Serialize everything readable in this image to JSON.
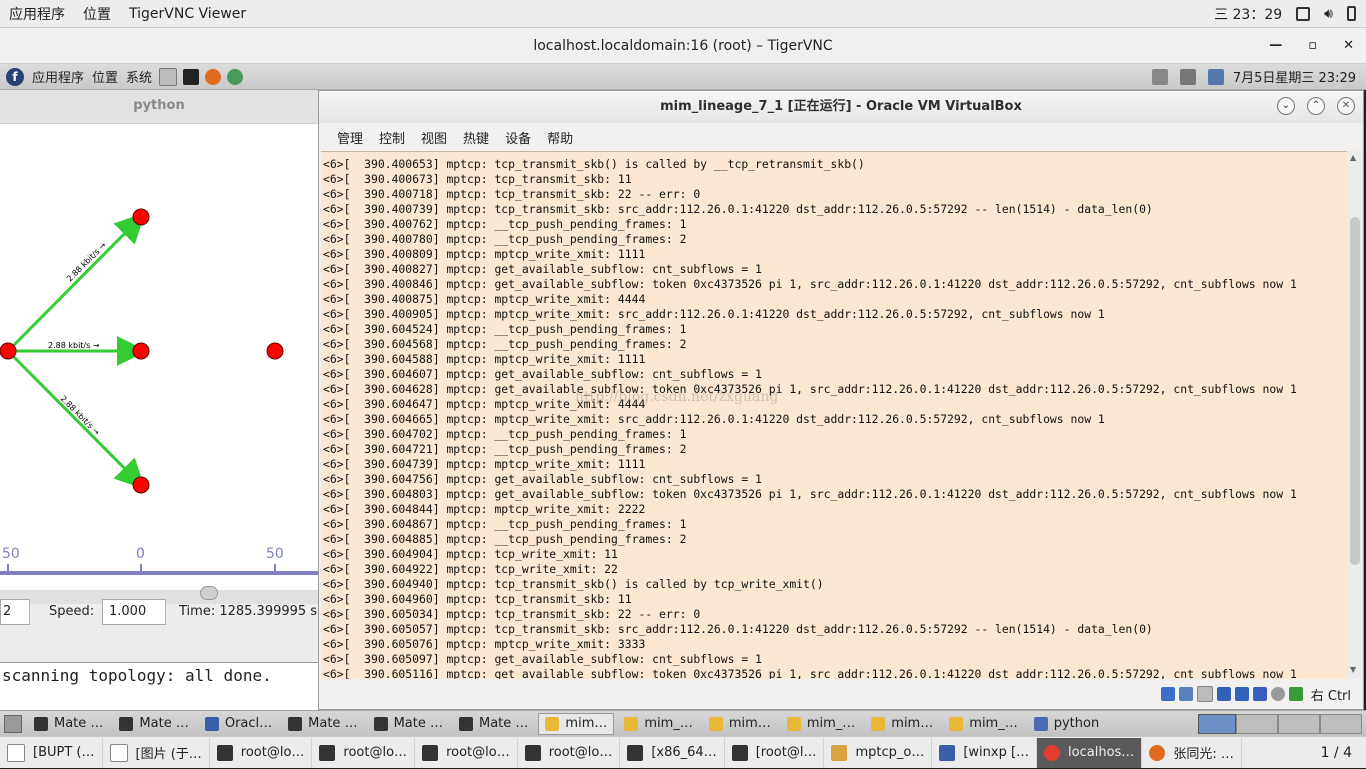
{
  "topbar": {
    "applications": "应用程序",
    "places": "位置",
    "app_name": "TigerVNC Viewer",
    "clock": "三 23：29"
  },
  "vnc_window": {
    "title": "localhost.localdomain:16 (root) – TigerVNC"
  },
  "remote_panel": {
    "applications": "应用程序",
    "places": "位置",
    "system": "系统",
    "datetime": "7月5日星期三 23:29"
  },
  "python_window": {
    "title": "python",
    "link_labels": [
      "2.88 kbit/s →",
      "2.88 kbit/s →",
      "2.88 kbit/s →"
    ],
    "ticks": [
      "50",
      "0",
      "50"
    ],
    "speed_label": "Speed:",
    "speed_value": "1.000",
    "time_text": "Time: 1285.399995 s",
    "left_spin_value": "2",
    "console_text": "scanning topology: all done."
  },
  "vbox": {
    "title": "mim_lineage_7_1 [正在运行] - Oracle VM VirtualBox",
    "menu": [
      "管理",
      "控制",
      "视图",
      "热键",
      "设备",
      "帮助"
    ],
    "host_key": "右 Ctrl",
    "watermark": "http://blog.csdn.net/zxguang",
    "console_lines": [
      "<6>[  390.400653] mptcp: tcp_transmit_skb() is called by __tcp_retransmit_skb()",
      "<6>[  390.400673] mptcp: tcp_transmit_skb: 11",
      "<6>[  390.400718] mptcp: tcp_transmit_skb: 22 -- err: 0",
      "<6>[  390.400739] mptcp: tcp_transmit_skb: src_addr:112.26.0.1:41220 dst_addr:112.26.0.5:57292 -- len(1514) - data_len(0)",
      "<6>[  390.400762] mptcp: __tcp_push_pending_frames: 1",
      "<6>[  390.400780] mptcp: __tcp_push_pending_frames: 2",
      "<6>[  390.400809] mptcp: mptcp_write_xmit: 1111",
      "<6>[  390.400827] mptcp: get_available_subflow: cnt_subflows = 1",
      "<6>[  390.400846] mptcp: get_available_subflow: token 0xc4373526 pi 1, src_addr:112.26.0.1:41220 dst_addr:112.26.0.5:57292, cnt_subflows now 1",
      "<6>[  390.400875] mptcp: mptcp_write_xmit: 4444",
      "<6>[  390.400905] mptcp: mptcp_write_xmit: src_addr:112.26.0.1:41220 dst_addr:112.26.0.5:57292, cnt_subflows now 1",
      "<6>[  390.604524] mptcp: __tcp_push_pending_frames: 1",
      "<6>[  390.604568] mptcp: __tcp_push_pending_frames: 2",
      "<6>[  390.604588] mptcp: mptcp_write_xmit: 1111",
      "<6>[  390.604607] mptcp: get_available_subflow: cnt_subflows = 1",
      "<6>[  390.604628] mptcp: get_available_subflow: token 0xc4373526 pi 1, src_addr:112.26.0.1:41220 dst_addr:112.26.0.5:57292, cnt_subflows now 1",
      "<6>[  390.604647] mptcp: mptcp_write_xmit: 4444",
      "<6>[  390.604665] mptcp: mptcp_write_xmit: src_addr:112.26.0.1:41220 dst_addr:112.26.0.5:57292, cnt_subflows now 1",
      "<6>[  390.604702] mptcp: __tcp_push_pending_frames: 1",
      "<6>[  390.604721] mptcp: __tcp_push_pending_frames: 2",
      "<6>[  390.604739] mptcp: mptcp_write_xmit: 1111",
      "<6>[  390.604756] mptcp: get_available_subflow: cnt_subflows = 1",
      "<6>[  390.604803] mptcp: get_available_subflow: token 0xc4373526 pi 1, src_addr:112.26.0.1:41220 dst_addr:112.26.0.5:57292, cnt_subflows now 1",
      "<6>[  390.604844] mptcp: mptcp_write_xmit: 2222",
      "<6>[  390.604867] mptcp: __tcp_push_pending_frames: 1",
      "<6>[  390.604885] mptcp: __tcp_push_pending_frames: 2",
      "<6>[  390.604904] mptcp: tcp_write_xmit: 11",
      "<6>[  390.604922] mptcp: tcp_write_xmit: 22",
      "<6>[  390.604940] mptcp: tcp_transmit_skb() is called by tcp_write_xmit()",
      "<6>[  390.604960] mptcp: tcp_transmit_skb: 11",
      "<6>[  390.605034] mptcp: tcp_transmit_skb: 22 -- err: 0",
      "<6>[  390.605057] mptcp: tcp_transmit_skb: src_addr:112.26.0.1:41220 dst_addr:112.26.0.5:57292 -- len(1514) - data_len(0)",
      "<6>[  390.605076] mptcp: mptcp_write_xmit: 3333",
      "<6>[  390.605097] mptcp: get_available_subflow: cnt_subflows = 1",
      "<6>[  390.605116] mptcp: get_available_subflow: token 0xc4373526 pi 1, src_addr:112.26.0.1:41220 dst_addr:112.26.0.5:57292, cnt_subflows now 1"
    ]
  },
  "inner_taskbar": [
    {
      "label": "Mate …",
      "icon": "terminal-icon"
    },
    {
      "label": "Mate …",
      "icon": "terminal-icon"
    },
    {
      "label": "Oracl…",
      "icon": "virtualbox-icon"
    },
    {
      "label": "Mate …",
      "icon": "terminal-icon"
    },
    {
      "label": "Mate …",
      "icon": "terminal-icon"
    },
    {
      "label": "Mate …",
      "icon": "terminal-icon"
    },
    {
      "label": "mim…",
      "icon": "vm-icon"
    },
    {
      "label": "mim_…",
      "icon": "vm-icon"
    },
    {
      "label": "mim…",
      "icon": "vm-icon"
    },
    {
      "label": "mim_…",
      "icon": "vm-icon"
    },
    {
      "label": "mim…",
      "icon": "vm-icon"
    },
    {
      "label": "mim_…",
      "icon": "vm-icon"
    },
    {
      "label": "python",
      "icon": "window-icon"
    }
  ],
  "outer_taskbar": [
    {
      "label": "[BUPT (…",
      "icon": "document-icon"
    },
    {
      "label": "[图片 (于…",
      "icon": "document-icon"
    },
    {
      "label": "root@lo…",
      "icon": "terminal-icon"
    },
    {
      "label": "root@lo…",
      "icon": "terminal-icon"
    },
    {
      "label": "root@lo…",
      "icon": "terminal-icon"
    },
    {
      "label": "root@lo…",
      "icon": "terminal-icon"
    },
    {
      "label": "[x86_64…",
      "icon": "terminal-icon"
    },
    {
      "label": "[root@l…",
      "icon": "terminal-icon"
    },
    {
      "label": "mptcp_o…",
      "icon": "editor-icon"
    },
    {
      "label": "[winxp […",
      "icon": "virtualbox-icon"
    },
    {
      "label": "localhos…",
      "icon": "vnc-icon"
    },
    {
      "label": "张同光: …",
      "icon": "firefox-icon"
    }
  ],
  "workspace": "1 / 4",
  "colors": {
    "console_bg": "#fbe7d2",
    "node": "#ff0000",
    "link": "#33cc33",
    "axis": "#8080c0"
  }
}
